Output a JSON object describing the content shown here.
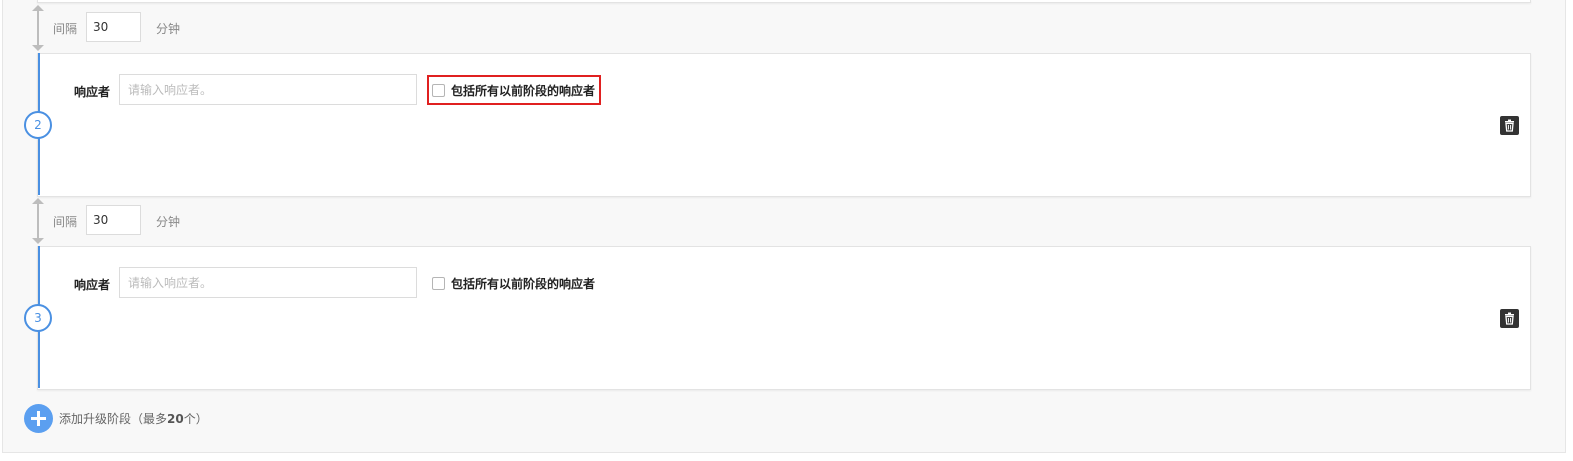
{
  "intervals": [
    {
      "label": "间隔",
      "value": "30",
      "unit": "分钟"
    },
    {
      "label": "间隔",
      "value": "30",
      "unit": "分钟"
    }
  ],
  "stages": [
    {
      "number": "2",
      "responder_label": "响应者",
      "responder_placeholder": "请输入响应者。",
      "include_previous_label": "包括所有以前阶段的响应者",
      "include_previous_checked": false,
      "delete_icon": "trash-icon"
    },
    {
      "number": "3",
      "responder_label": "响应者",
      "responder_placeholder": "请输入响应者。",
      "include_previous_label": "包括所有以前阶段的响应者",
      "include_previous_checked": false,
      "delete_icon": "trash-icon"
    }
  ],
  "add_stage": {
    "text_before": "添加升级阶段（最多",
    "max": "20",
    "text_after": "个）"
  },
  "colors": {
    "accent": "#4a90e2",
    "highlight": "#e02020",
    "add_button": "#5b9ff0"
  }
}
